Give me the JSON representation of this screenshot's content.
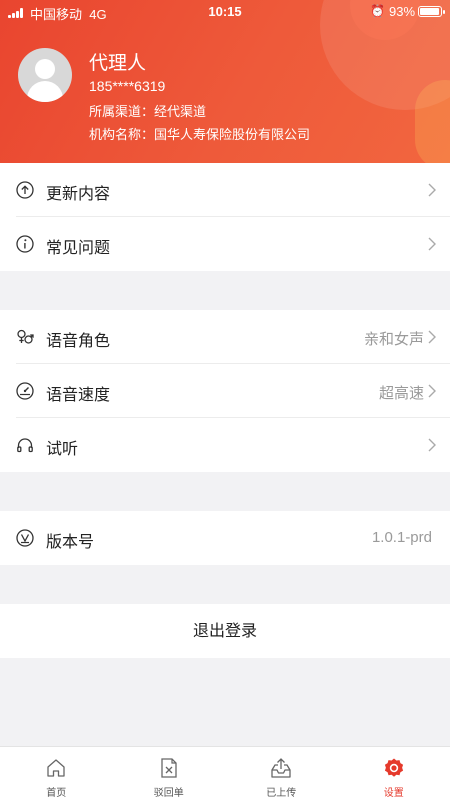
{
  "status": {
    "carrier": "中国移动",
    "network": "4G",
    "time": "10:15",
    "battery": "93%",
    "battery_level": 0.93
  },
  "profile": {
    "name": "代理人",
    "phone": "185****6319",
    "channel": "所属渠道：经代渠道",
    "org": "机构名称：国华人寿保险股份有限公司"
  },
  "sections": {
    "updates": {
      "label": "更新内容",
      "icon": "arrow-up-circle-icon"
    },
    "faq": {
      "label": "常见问题",
      "icon": "info-circle-icon"
    },
    "voice_role": {
      "label": "语音角色",
      "value": "亲和女声",
      "icon": "gender-icon"
    },
    "voice_speed": {
      "label": "语音速度",
      "value": "超高速",
      "icon": "speedometer-icon"
    },
    "listen": {
      "label": "试听",
      "icon": "headphones-icon"
    },
    "version": {
      "label": "版本号",
      "value": "1.0.1-prd",
      "icon": "version-v-icon"
    }
  },
  "logout": "退出登录",
  "tabs": [
    {
      "label": "首页",
      "icon": "home-icon"
    },
    {
      "label": "驳回单",
      "icon": "rejected-document-icon"
    },
    {
      "label": "已上传",
      "icon": "upload-tray-icon"
    },
    {
      "label": "设置",
      "icon": "settings-gear-icon",
      "active": true
    }
  ],
  "colors": {
    "header_start": "#e9452f",
    "header_end": "#f2663f",
    "accent": "#e53a2c",
    "page_bg": "#f2f2f4"
  }
}
